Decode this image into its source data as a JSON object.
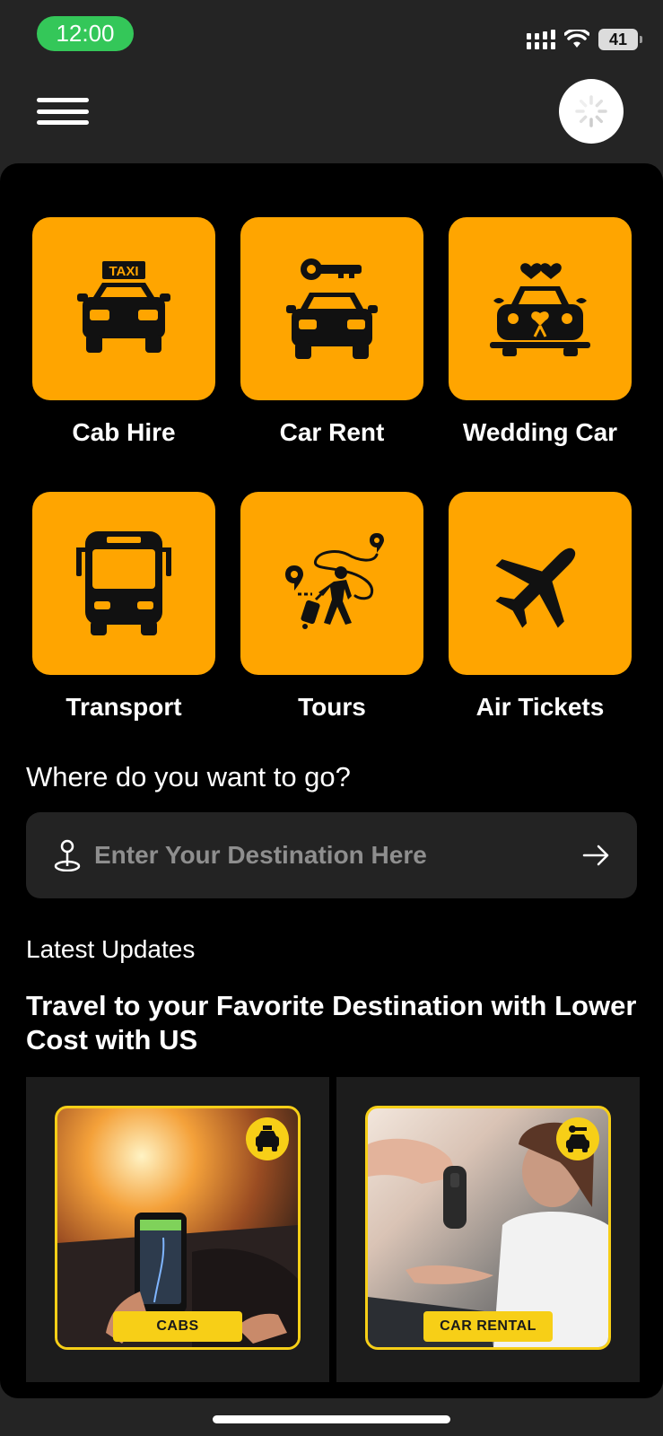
{
  "status": {
    "time": "12:00",
    "battery": "41"
  },
  "services": [
    {
      "label": "Cab Hire",
      "icon": "taxi-icon",
      "sign": "TAXI"
    },
    {
      "label": "Car Rent",
      "icon": "car-key-icon"
    },
    {
      "label": "Wedding Car",
      "icon": "wedding-car-icon"
    },
    {
      "label": "Transport",
      "icon": "bus-icon"
    },
    {
      "label": "Tours",
      "icon": "traveler-route-icon"
    },
    {
      "label": "Air Tickets",
      "icon": "airplane-icon"
    }
  ],
  "search": {
    "question": "Where do you want to go?",
    "placeholder": "Enter Your Destination Here"
  },
  "updates": {
    "label": "Latest Updates",
    "headline": "Travel to your Favorite Destination with Lower Cost with US",
    "cards": [
      {
        "tag": "CABS",
        "icon": "taxi-icon"
      },
      {
        "tag": "CAR RENTAL",
        "icon": "car-key-icon"
      }
    ]
  },
  "colors": {
    "accent": "#FFA500",
    "card_frame": "#F7CF17",
    "status_pill": "#34C759",
    "background": "#000000",
    "header": "#242424"
  }
}
